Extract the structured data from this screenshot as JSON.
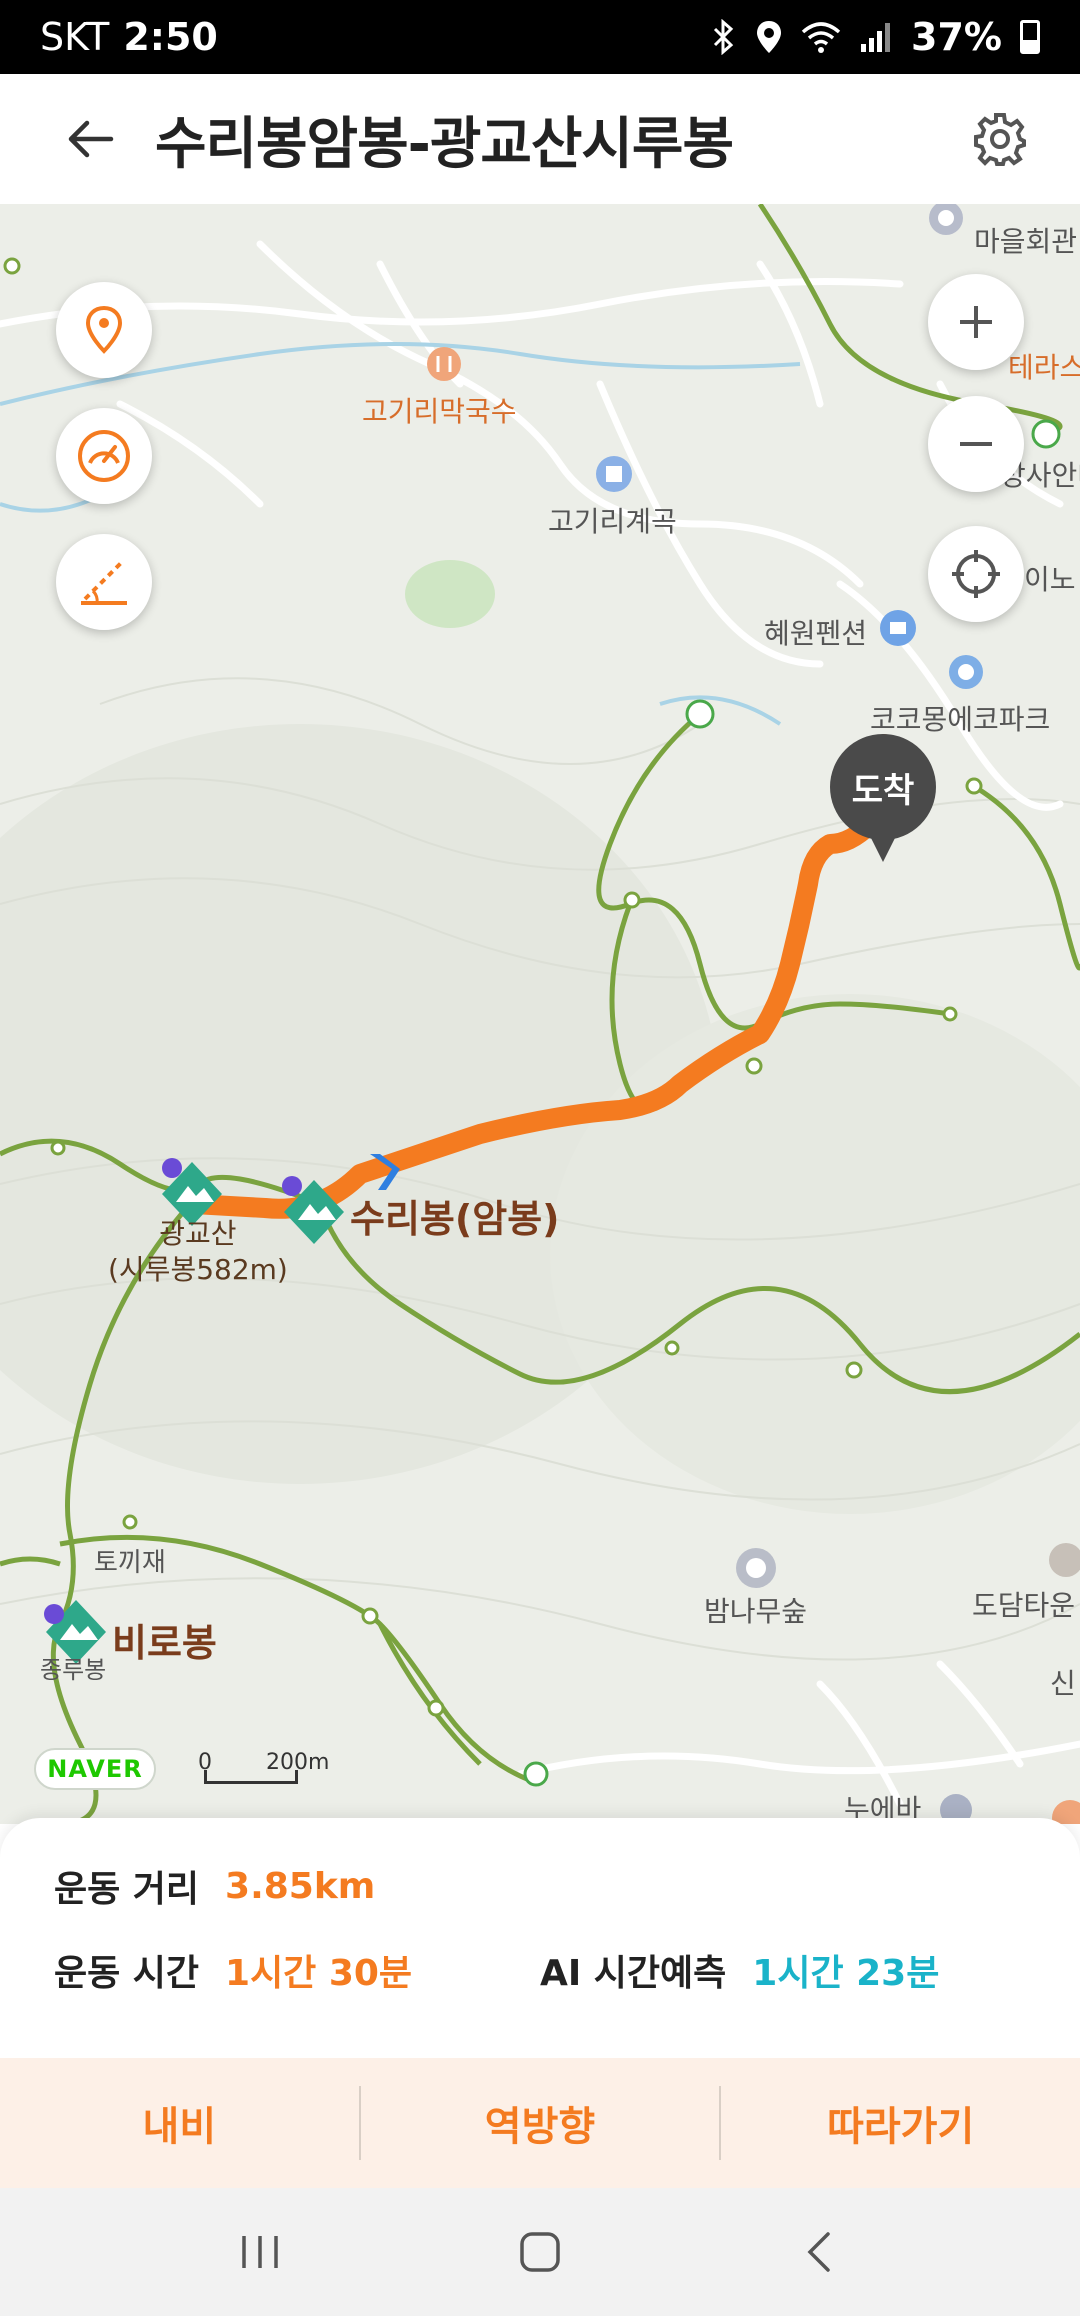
{
  "status_bar": {
    "carrier": "SKT",
    "time": "2:50",
    "battery": "37%"
  },
  "header": {
    "title": "수리봉암봉-광교산시루봉",
    "back_icon": "arrow-left-icon",
    "settings_icon": "gear-icon"
  },
  "map": {
    "labels": {
      "gogiri_noodle": "고기리막국수",
      "gogiri_valley": "고기리계곡",
      "hyewon_pension": "혜원펜션",
      "cocomong_park": "코코몽에코파크",
      "village_hall": "마을회관",
      "terrace": "테라스",
      "guide": "방사안내",
      "ino": "이노",
      "gwanggyosan": "광교산",
      "sirubong": "(시루봉582m)",
      "suribong": "수리봉(암봉)",
      "tokkijae": "토끼재",
      "birobong": "비로봉",
      "jongrubong": "종루봉",
      "bamnamu_forest": "밤나무숲",
      "dodam_town": "도담타운",
      "sin": "신",
      "nueba": "누에바"
    },
    "arrive_label": "도착",
    "naver_badge": "NAVER",
    "scale": {
      "zero": "0",
      "distance": "200m"
    },
    "route_color": "#f47b20",
    "trail_color": "#7aa33f"
  },
  "info": {
    "distance_label": "운동 거리",
    "distance_value": "3.85km",
    "time_label": "운동 시간",
    "time_value": "1시간 30분",
    "ai_label": "AI 시간예측",
    "ai_value": "1시간 23분"
  },
  "actions": {
    "nav": "내비",
    "reverse": "역방향",
    "follow": "따라가기"
  },
  "colors": {
    "accent": "#f47b20",
    "teal": "#1ab3c9",
    "action_bg": "#fdf0e7"
  }
}
